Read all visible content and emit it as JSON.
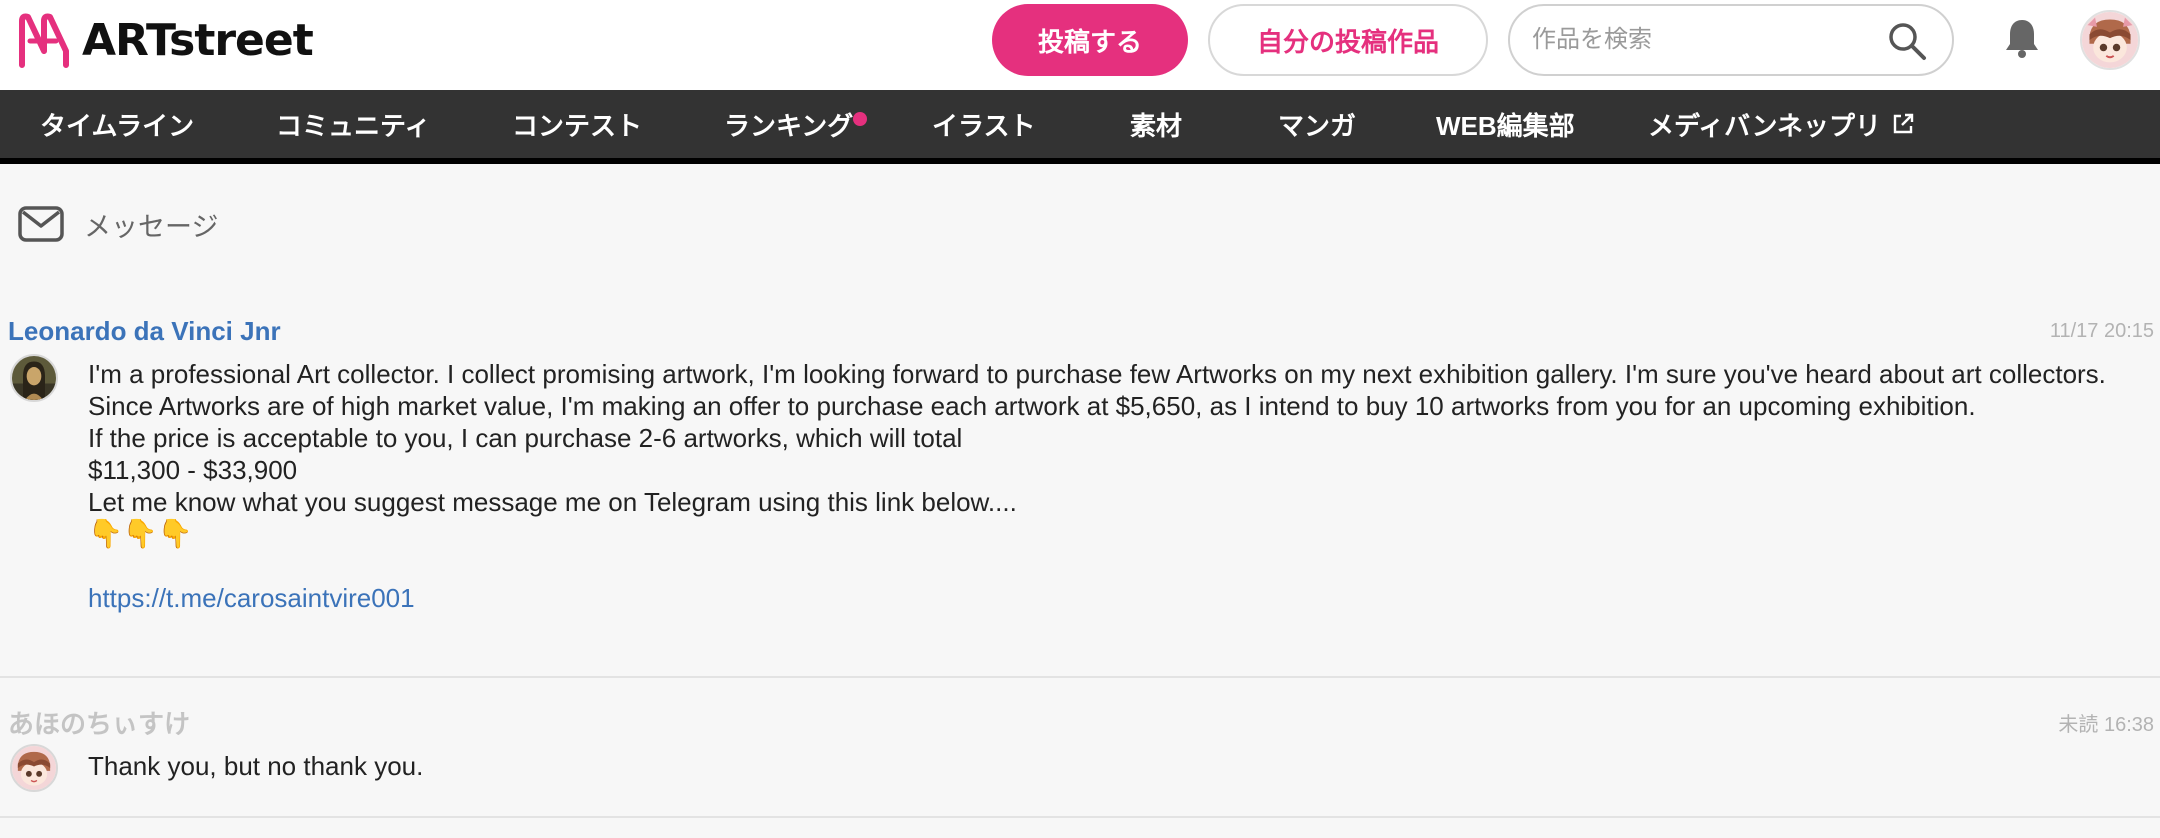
{
  "header": {
    "logo_text": "ARTstreet",
    "post_button": "投稿する",
    "my_works_button": "自分の投稿作品",
    "search_placeholder": "作品を検索"
  },
  "nav": {
    "items": [
      {
        "label": "タイムライン"
      },
      {
        "label": "コミュニティ"
      },
      {
        "label": "コンテスト"
      },
      {
        "label": "ランキング",
        "badge": true
      },
      {
        "label": "イラスト"
      },
      {
        "label": "素材"
      },
      {
        "label": "マンガ"
      },
      {
        "label": "WEB編集部"
      },
      {
        "label": "メディバンネップリ",
        "external": true
      }
    ]
  },
  "page": {
    "title": "メッセージ"
  },
  "messages": [
    {
      "sender": "Leonardo da Vinci Jnr",
      "sender_color": "#3b73b9",
      "time": "11/17 20:15",
      "lines": [
        "I'm a professional Art collector. I collect promising artwork, I'm looking forward to purchase few Artworks on my next exhibition gallery. I'm sure you've heard about art collectors.",
        "Since Artworks are of high market value, I'm making an offer to purchase each artwork at $5,650, as I intend to buy 10 artworks from you for an upcoming exhibition.",
        "If the price is acceptable to you, I can purchase 2-6 artworks, which will total",
        "$11,300 - $33,900",
        "Let me know what you suggest message me on Telegram using this link below....",
        "👇👇👇",
        "",
        "https://t.me/carosaintvire001"
      ]
    },
    {
      "sender": "あほのちぃすけ",
      "sender_color": "#c4c4c4",
      "time": "未読 16:38",
      "lines": [
        "Thank you, but no thank you."
      ]
    }
  ],
  "colors": {
    "brand_pink": "#e5307e",
    "nav_bg": "#333333",
    "link_blue": "#3b73b9"
  }
}
